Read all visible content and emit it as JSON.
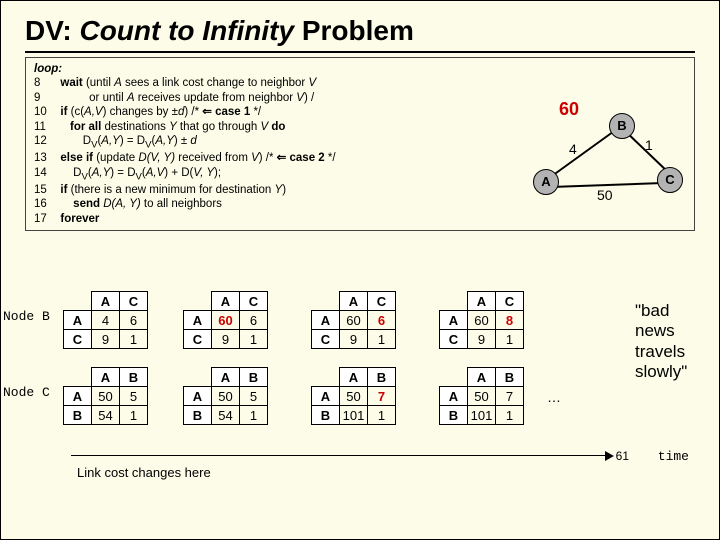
{
  "title": {
    "pre": "DV: ",
    "italic": "Count to Infinity",
    "post": " Problem"
  },
  "code": {
    "loop": "loop:",
    "l8": {
      "num": "8",
      "txt": "wait (until A sees a link cost change to neighbor V"
    },
    "l9": {
      "num": "9",
      "txt": "or until A receives update from neighbor V) /"
    },
    "l10": {
      "num": "10",
      "pre": "if (c(A,V) changes by ±d)  /* ",
      "case": "⇐ case 1",
      "post": " */"
    },
    "l11": {
      "num": "11",
      "txt": "for all destinations Y that go through V do"
    },
    "l12": {
      "num": "12",
      "txt": "D_V(A,Y) = D_V(A,Y) ± d"
    },
    "l13": {
      "num": "13",
      "pre": "else if (update D(V, Y) received from V) /* ",
      "case": "⇐ case 2",
      "post": " */"
    },
    "l14": {
      "num": "14",
      "txt": "D_V(A,Y) = D_V(A,V) + D(V, Y);"
    },
    "l15": {
      "num": "15",
      "txt": "if (there is a new minimum for destination Y)"
    },
    "l16": {
      "num": "16",
      "txt": "send D(A, Y) to all neighbors"
    },
    "l17": {
      "num": "17",
      "txt": "forever"
    }
  },
  "graph": {
    "A": "A",
    "B": "B",
    "C": "C",
    "e_ab_old": "4",
    "e_ab_new": "60",
    "e_bc": "1",
    "e_ac": "50"
  },
  "labels": {
    "nodeB": "Node B",
    "nodeC": "Node C",
    "time": "time",
    "lcc": "Link cost changes here",
    "page": "61",
    "dots": "…"
  },
  "tb": {
    "b0": {
      "h1": "A",
      "h2": "C",
      "r1": [
        "A",
        "4",
        "6"
      ],
      "r2": [
        "C",
        "9",
        "1"
      ]
    },
    "b1": {
      "h1": "A",
      "h2": "C",
      "r1": [
        "A",
        "60",
        "6"
      ],
      "r2": [
        "C",
        "9",
        "1"
      ],
      "red": [
        1,
        1
      ]
    },
    "b2": {
      "h1": "A",
      "h2": "C",
      "r1": [
        "A",
        "60",
        "6"
      ],
      "r2": [
        "C",
        "9",
        "1"
      ],
      "red": [
        1,
        2
      ]
    },
    "b3": {
      "h1": "A",
      "h2": "C",
      "r1": [
        "A",
        "60",
        "8"
      ],
      "r2": [
        "C",
        "9",
        "1"
      ],
      "red": [
        1,
        2
      ]
    },
    "c0": {
      "h1": "A",
      "h2": "B",
      "r1": [
        "A",
        "50",
        "5"
      ],
      "r2": [
        "B",
        "54",
        "1"
      ]
    },
    "c1": {
      "h1": "A",
      "h2": "B",
      "r1": [
        "A",
        "50",
        "5"
      ],
      "r2": [
        "B",
        "54",
        "1"
      ]
    },
    "c2": {
      "h1": "A",
      "h2": "B",
      "r1": [
        "A",
        "50",
        "7"
      ],
      "r2": [
        "B",
        "101",
        "1"
      ],
      "red": [
        1,
        2
      ]
    },
    "c3": {
      "h1": "A",
      "h2": "B",
      "r1": [
        "A",
        "50",
        "7"
      ],
      "r2": [
        "B",
        "101",
        "1"
      ]
    }
  },
  "quote": "\"bad news travels slowly\""
}
